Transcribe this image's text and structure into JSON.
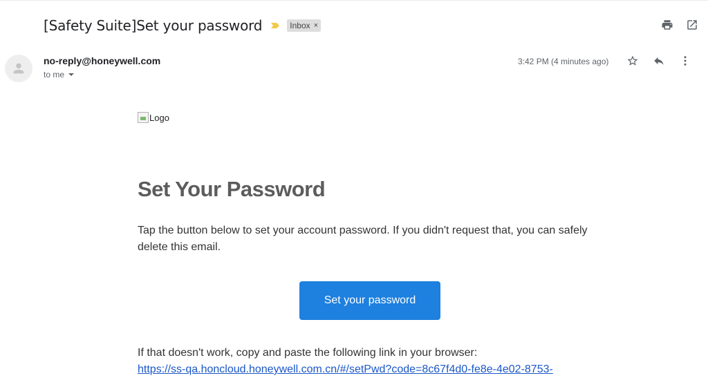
{
  "header": {
    "subject": "[Safety Suite]Set your password",
    "label": "Inbox",
    "label_close": "×",
    "importance_color": "#f2c94c",
    "actions": [
      "print-icon",
      "open-in-new-window-icon"
    ]
  },
  "message": {
    "sender": "no-reply@honeywell.com",
    "recipient": "to me",
    "timestamp": "3:42 PM (4 minutes ago)",
    "actions": [
      "star-icon",
      "reply-icon",
      "more-vert-icon"
    ]
  },
  "email": {
    "logo_alt": "Logo",
    "title": "Set Your Password",
    "body": "Tap the button below to set your account password. If you didn't request that, you can safely delete this email.",
    "button_label": "Set your password",
    "button_color": "#1e80df",
    "fallback_text": "If that doesn't work, copy and paste the following link in your browser:",
    "link_text": "https://ss-qa.honcloud.honeywell.com.cn/#/setPwd?code=8c67f4d0-fe8e-4e02-8753-",
    "link_color": "#1a57c7"
  }
}
